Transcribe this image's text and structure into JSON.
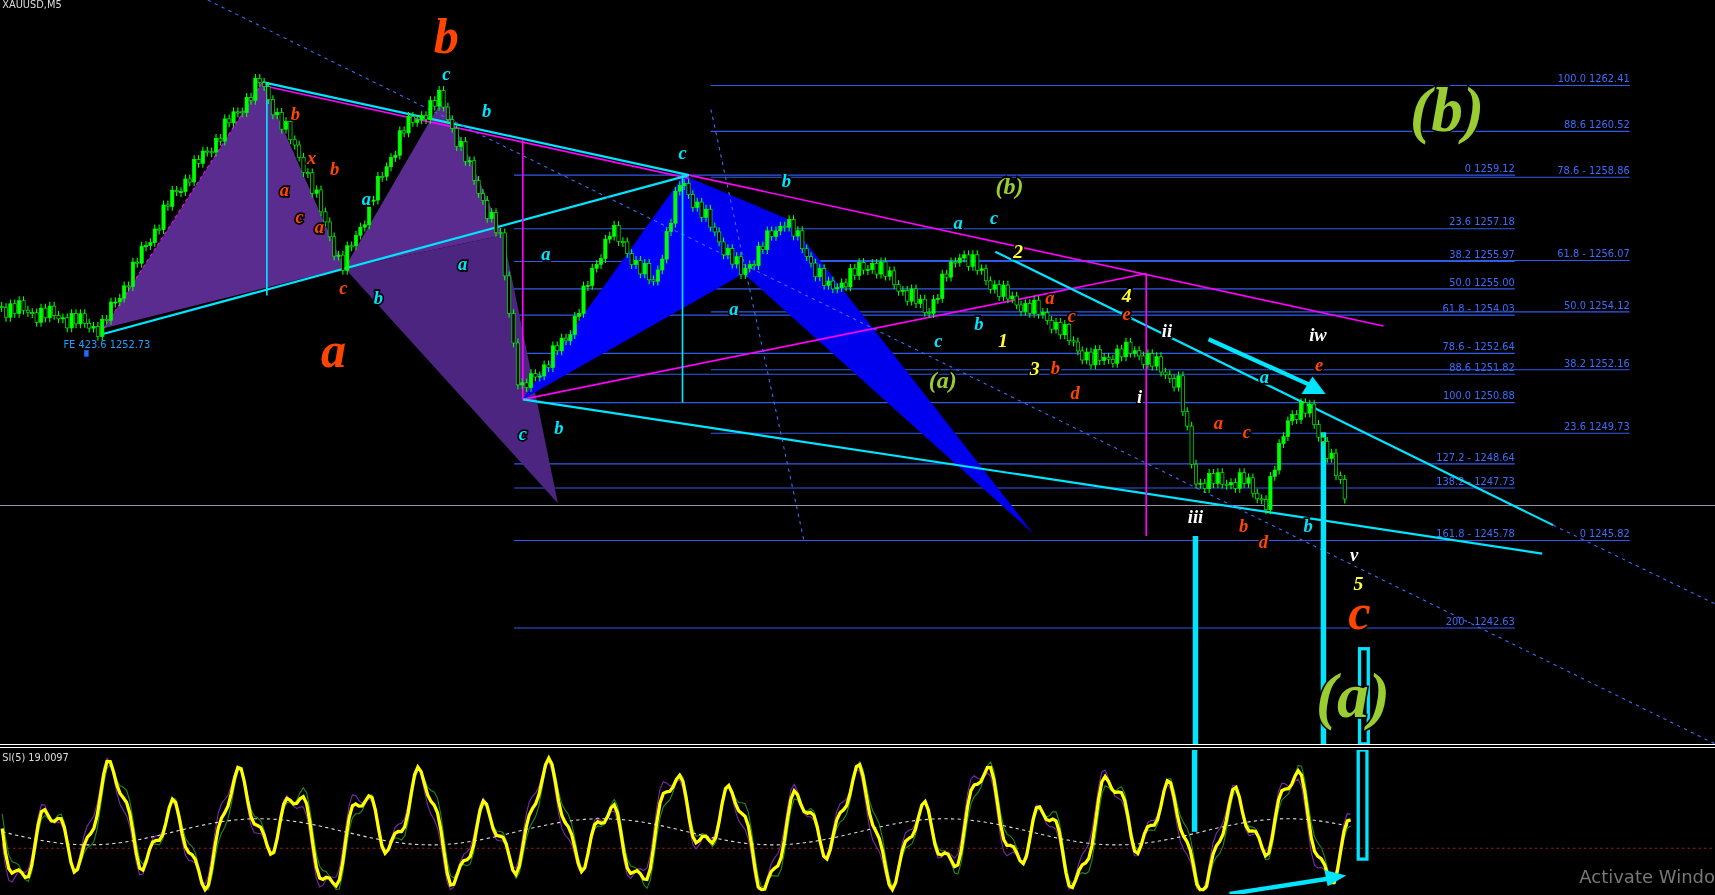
{
  "chart": {
    "symbol": "XAUUSD,M5",
    "fe_label": "FE 423.6 1252.73",
    "fib_levels": [
      {
        "label": "100.0 1262.41"
      },
      {
        "label": "88.6 1260.52"
      },
      {
        "label": "0 1259.12"
      },
      {
        "label": "78.6 - 1258.86"
      },
      {
        "label": "23.6 1257.18"
      },
      {
        "label": "38.2 1255.97"
      },
      {
        "label": "61.8 - 1256.07"
      },
      {
        "label": "50.0 1255.00"
      },
      {
        "label": "61.8 - 1254.03"
      },
      {
        "label": "50.0 1254.12"
      },
      {
        "label": "78.6 - 1252.64"
      },
      {
        "label": "88.6 1251.82"
      },
      {
        "label": "38.2 1252.16"
      },
      {
        "label": "100.0 1250.88"
      },
      {
        "label": "23.6 1249.73"
      },
      {
        "label": "127.2 - 1248.64"
      },
      {
        "label": "138.2 - 1247.73"
      },
      {
        "label": "161.8 - 1245.78"
      },
      {
        "label": "0 1245.82"
      },
      {
        "label": "200 - 1242.63"
      }
    ],
    "wave_labels": [
      {
        "text": "b",
        "color": "#ff4500"
      },
      {
        "text": "c",
        "color": "#00e5ff"
      },
      {
        "text": "b",
        "color": "#ff4500"
      },
      {
        "text": "b",
        "color": "#00e5ff"
      },
      {
        "text": "(b)",
        "color": "#9acd32"
      },
      {
        "text": "x",
        "color": "#ff4500"
      },
      {
        "text": "b",
        "color": "#ff4500"
      },
      {
        "text": "c",
        "color": "#00e5ff"
      },
      {
        "text": "a",
        "color": "#ff4500"
      },
      {
        "text": "a",
        "color": "#00e5ff"
      },
      {
        "text": "b",
        "color": "#00e5ff"
      },
      {
        "text": "(b)",
        "color": "#9acd32"
      },
      {
        "text": "c",
        "color": "#ff4500"
      },
      {
        "text": "a",
        "color": "#ff4500"
      },
      {
        "text": "a",
        "color": "#00e5ff"
      },
      {
        "text": "c",
        "color": "#00e5ff"
      },
      {
        "text": "a",
        "color": "#00e5ff"
      },
      {
        "text": "a",
        "color": "#00e5ff"
      },
      {
        "text": "2",
        "color": "#ffff33"
      },
      {
        "text": "c",
        "color": "#ff4500"
      },
      {
        "text": "b",
        "color": "#00e5ff"
      },
      {
        "text": "a",
        "color": "#ff4500"
      },
      {
        "text": "4",
        "color": "#ffff33"
      },
      {
        "text": "a",
        "color": "#ff4500"
      },
      {
        "text": "a",
        "color": "#00e5ff"
      },
      {
        "text": "c",
        "color": "#00e5ff"
      },
      {
        "text": "b",
        "color": "#00e5ff"
      },
      {
        "text": "1",
        "color": "#ffff33"
      },
      {
        "text": "c",
        "color": "#ff4500"
      },
      {
        "text": "e",
        "color": "#ff4500"
      },
      {
        "text": "ii",
        "color": "#ffffff"
      },
      {
        "text": "iw",
        "color": "#ffffff"
      },
      {
        "text": "(a)",
        "color": "#9acd32"
      },
      {
        "text": "3",
        "color": "#ffff33"
      },
      {
        "text": "b",
        "color": "#ff4500"
      },
      {
        "text": "d",
        "color": "#ff4500"
      },
      {
        "text": "i",
        "color": "#ffffff"
      },
      {
        "text": "a",
        "color": "#00e5ff"
      },
      {
        "text": "e",
        "color": "#ff4500"
      },
      {
        "text": "c",
        "color": "#00e5ff"
      },
      {
        "text": "b",
        "color": "#00e5ff"
      },
      {
        "text": "a",
        "color": "#ff4500"
      },
      {
        "text": "c",
        "color": "#ff4500"
      },
      {
        "text": "iii",
        "color": "#ffffff"
      },
      {
        "text": "b",
        "color": "#ff4500"
      },
      {
        "text": "d",
        "color": "#ff4500"
      },
      {
        "text": "b",
        "color": "#00e5ff"
      },
      {
        "text": "v",
        "color": "#ffffff"
      },
      {
        "text": "5",
        "color": "#ffff33"
      },
      {
        "text": "c",
        "color": "#ff4500"
      },
      {
        "text": "(a)",
        "color": "#9acd32"
      }
    ]
  },
  "indicator": {
    "label": "SI(5) 19.0097"
  },
  "system_notice": "Activate Windo"
}
